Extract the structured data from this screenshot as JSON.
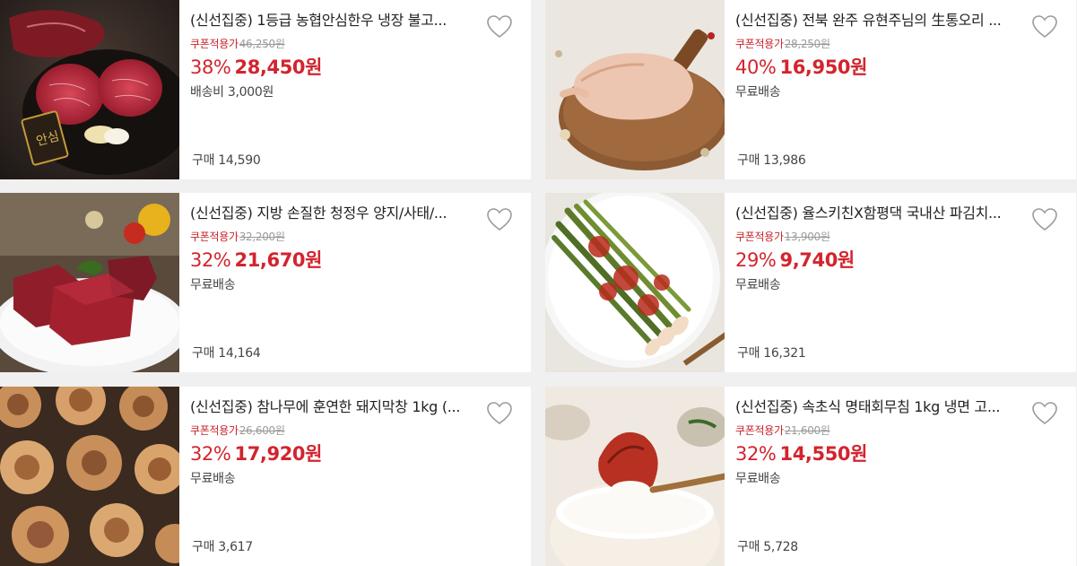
{
  "products": [
    {
      "title": "(신선집중) 1등급 농협안심한우 냉장 불고...",
      "coupon_label": "쿠폰적용가",
      "original_price": "46,250원",
      "discount": "38%",
      "price": "28,450원",
      "shipping": "배송비 3,000원",
      "sales": "구매 14,590",
      "image": "beef-steak-photo"
    },
    {
      "title": "(신선집중) 전북 완주 유현주님의 生통오리 ...",
      "coupon_label": "쿠폰적용가",
      "original_price": "28,250원",
      "discount": "40%",
      "price": "16,950원",
      "shipping": "무료배송",
      "sales": "구매 13,986",
      "image": "whole-duck-photo"
    },
    {
      "title": "(신선집중) 지방 손질한 청정우 양지/사태/...",
      "coupon_label": "쿠폰적용가",
      "original_price": "32,200원",
      "discount": "32%",
      "price": "21,670원",
      "shipping": "무료배송",
      "sales": "구매 14,164",
      "image": "beef-cubes-photo"
    },
    {
      "title": "(신선집중) 율스키친X함평댁 국내산 파김치...",
      "coupon_label": "쿠폰적용가",
      "original_price": "13,900원",
      "discount": "29%",
      "price": "9,740원",
      "shipping": "무료배송",
      "sales": "구매 16,321",
      "image": "green-onion-kimchi-photo"
    },
    {
      "title": "(신선집중) 참나무에 훈연한 돼지막창 1kg (...",
      "coupon_label": "쿠폰적용가",
      "original_price": "26,600원",
      "discount": "32%",
      "price": "17,920원",
      "shipping": "무료배송",
      "sales": "구매 3,617",
      "image": "pork-intestine-photo"
    },
    {
      "title": "(신선집중) 속초식 명태회무침 1kg 냉면 고...",
      "coupon_label": "쿠폰적용가",
      "original_price": "21,600원",
      "discount": "32%",
      "price": "14,550원",
      "shipping": "무료배송",
      "sales": "구매 5,728",
      "image": "pollock-salad-rice-photo"
    }
  ],
  "colors": {
    "accent": "#d3242e",
    "coupon": "#c8242b",
    "strike": "#9a9a9a",
    "background": "#f0f0f0"
  }
}
